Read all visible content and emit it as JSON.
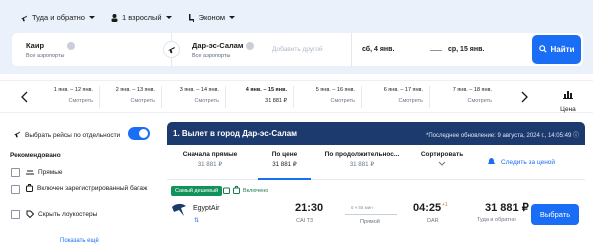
{
  "search_options": {
    "trip_type": "Туда и обратно",
    "passengers": "1 взрослый",
    "cabin": "Эконом"
  },
  "search": {
    "from_city": "Каир",
    "from_airports": "Все аэропорты",
    "to_city": "Дар-эс-Салам",
    "to_airports": "Все аэропорты",
    "add_another_placeholder": "Добавить другой",
    "depart_date": "сб, 4 янв.",
    "return_date": "ср, 15 янв.",
    "find_button": "Найти"
  },
  "date_strip": {
    "cells": [
      {
        "label": "1 янв. – 12 янв.",
        "price": "Смотреть"
      },
      {
        "label": "2 янв. – 13 янв.",
        "price": "Смотреть"
      },
      {
        "label": "3 янв. – 14 янв.",
        "price": "Смотреть"
      },
      {
        "label": "4 янв. – 15 янв.",
        "price": "31 881 ₽"
      },
      {
        "label": "5 янв. – 16 янв.",
        "price": "Смотреть"
      },
      {
        "label": "6 янв. – 17 янв.",
        "price": "Смотреть"
      },
      {
        "label": "7 янв. – 18 янв.",
        "price": "Смотреть"
      }
    ],
    "price_chart_label": "Цена"
  },
  "filters": {
    "select_separately": "Выбрать рейсы по отдельности",
    "recommended_title": "Рекомендовано",
    "items": [
      "Прямые",
      "Включен зарегистрированный багаж",
      "Скрыть лоукостеры"
    ],
    "more": "Показать ещё"
  },
  "results": {
    "header_title": "1. Вылет в город Дар-эс-Салам",
    "last_update": "*Последнее обновление: 9 августа, 2024 г., 14:05:49",
    "sort_tabs": [
      {
        "label": "Сначала прямые",
        "price": "31 881 ₽"
      },
      {
        "label": "По цене",
        "price": "31 881 ₽"
      },
      {
        "label": "По продолжительнос...",
        "price": "31 881 ₽"
      },
      {
        "label": "Сортировать",
        "price": ""
      }
    ],
    "track_prices": "Следить за ценой",
    "cheapest_badge": "Самый дешевый",
    "included": "Включено",
    "flight": {
      "airline": "EgyptAir",
      "depart_time": "21:30",
      "depart_airport": "CAI T3",
      "duration": "5 ч 55 мин",
      "stops": "Прямой",
      "arrive_time": "04:25",
      "day_offset": "+1",
      "arrive_airport": "DAR",
      "price": "31 881 ₽",
      "price_type": "Туда и обратно",
      "select_button": "Выбрать"
    }
  }
}
